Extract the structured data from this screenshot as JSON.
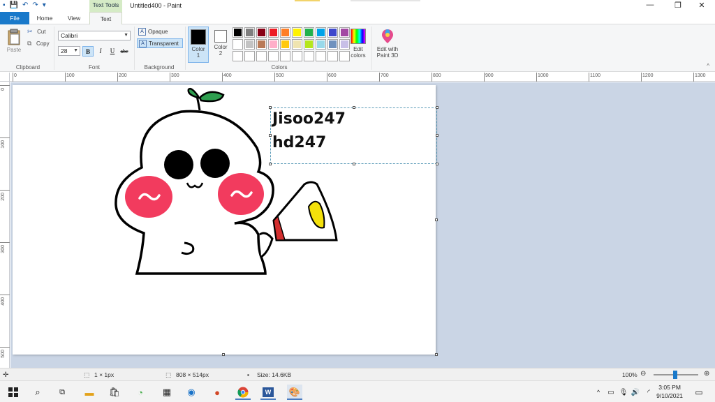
{
  "title_bar": {
    "context_tab": "Text Tools",
    "window_title": "Untitled400 - Paint",
    "controls": [
      "minimize-icon",
      "maximize-icon",
      "close-icon"
    ]
  },
  "ribbon_tabs": [
    {
      "label": "File"
    },
    {
      "label": "Home"
    },
    {
      "label": "View"
    },
    {
      "label": "Text"
    }
  ],
  "clipboard": {
    "paste": "Paste",
    "cut": "Cut",
    "copy": "Copy",
    "group_label": "Clipboard"
  },
  "font": {
    "family": "Calibri",
    "size": "28",
    "bold": "B",
    "italic": "I",
    "underline": "U",
    "strikethrough": "abc",
    "group_label": "Font"
  },
  "background": {
    "opaque": "Opaque",
    "transparent": "Transparent",
    "group_label": "Background"
  },
  "colors": {
    "color1_label": "Color",
    "color1_num": "1",
    "color2_label": "Color",
    "color2_num": "2",
    "color1_value": "#000000",
    "color2_value": "#ffffff",
    "edit_colors_line1": "Edit",
    "edit_colors_line2": "colors",
    "paint3d_line1": "Edit with",
    "paint3d_line2": "Paint 3D",
    "group_label": "Colors",
    "palette": [
      "#000000",
      "#7f7f7f",
      "#880015",
      "#ed1c24",
      "#ff7f27",
      "#fff200",
      "#22b14c",
      "#00a2e8",
      "#3f48cc",
      "#a349a4",
      "#ffffff",
      "#c3c3c3",
      "#b97a57",
      "#ffaec9",
      "#ffc90e",
      "#efe4b0",
      "#b5e61d",
      "#99d9ea",
      "#7092be",
      "#c8bfe7",
      "#ffffff",
      "#ffffff",
      "#ffffff",
      "#ffffff",
      "#ffffff",
      "#ffffff",
      "#ffffff",
      "#ffffff",
      "#ffffff",
      "#ffffff"
    ]
  },
  "ruler": {
    "h_labels": [
      "0",
      "100",
      "200",
      "300",
      "400",
      "500",
      "600",
      "700",
      "800",
      "900",
      "1000",
      "1100",
      "1200",
      "1300"
    ],
    "v_labels": [
      "0",
      "100",
      "200",
      "300",
      "400",
      "500"
    ]
  },
  "canvas": {
    "text_lines": [
      "Jisoo247",
      "hd247"
    ]
  },
  "status_bar": {
    "selection_size": "1 × 1px",
    "image_size": "808 × 514px",
    "file_size": "Size: 14.6KB",
    "zoom": "100%"
  },
  "taskbar": {
    "time": "3:05 PM",
    "date": "9/10/2021"
  }
}
